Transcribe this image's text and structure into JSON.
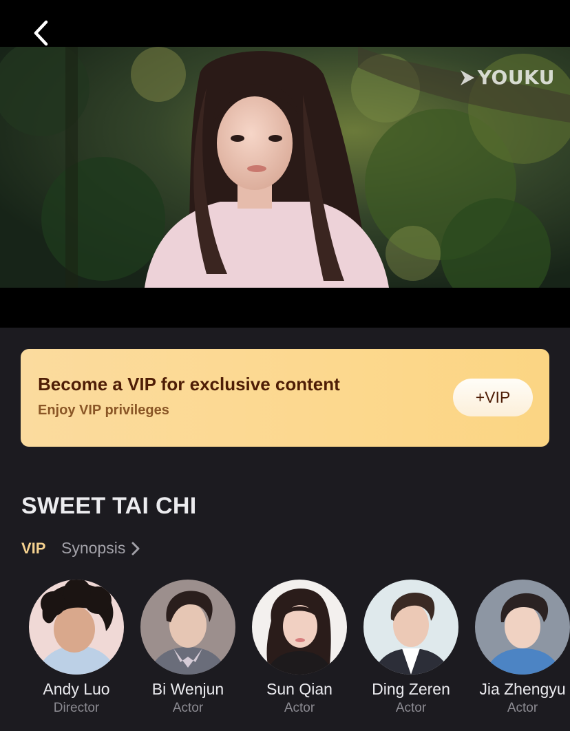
{
  "brand": {
    "watermark": "YOUKU"
  },
  "vip_banner": {
    "title": "Become a VIP for exclusive content",
    "subtitle": "Enjoy VIP privileges",
    "button_label": "+VIP"
  },
  "show": {
    "title": "SWEET TAI CHI",
    "badge": "VIP",
    "synopsis_label": "Synopsis"
  },
  "cast": [
    {
      "name": "Andy Luo",
      "role": "Director"
    },
    {
      "name": "Bi Wenjun",
      "role": "Actor"
    },
    {
      "name": "Sun Qian",
      "role": "Actor"
    },
    {
      "name": "Ding Zeren",
      "role": "Actor"
    },
    {
      "name": "Jia Zhengyu",
      "role": "Actor"
    }
  ],
  "icons": {
    "back": "chevron-left-icon",
    "synopsis": "chevron-right-icon",
    "logo": "youku-play-icon"
  },
  "colors": {
    "page_background": "#1c1b20",
    "vip_gold": "#f6d28f",
    "vip_banner_text": "#4e1d06",
    "vip_banner_subtext": "#8a5626"
  }
}
